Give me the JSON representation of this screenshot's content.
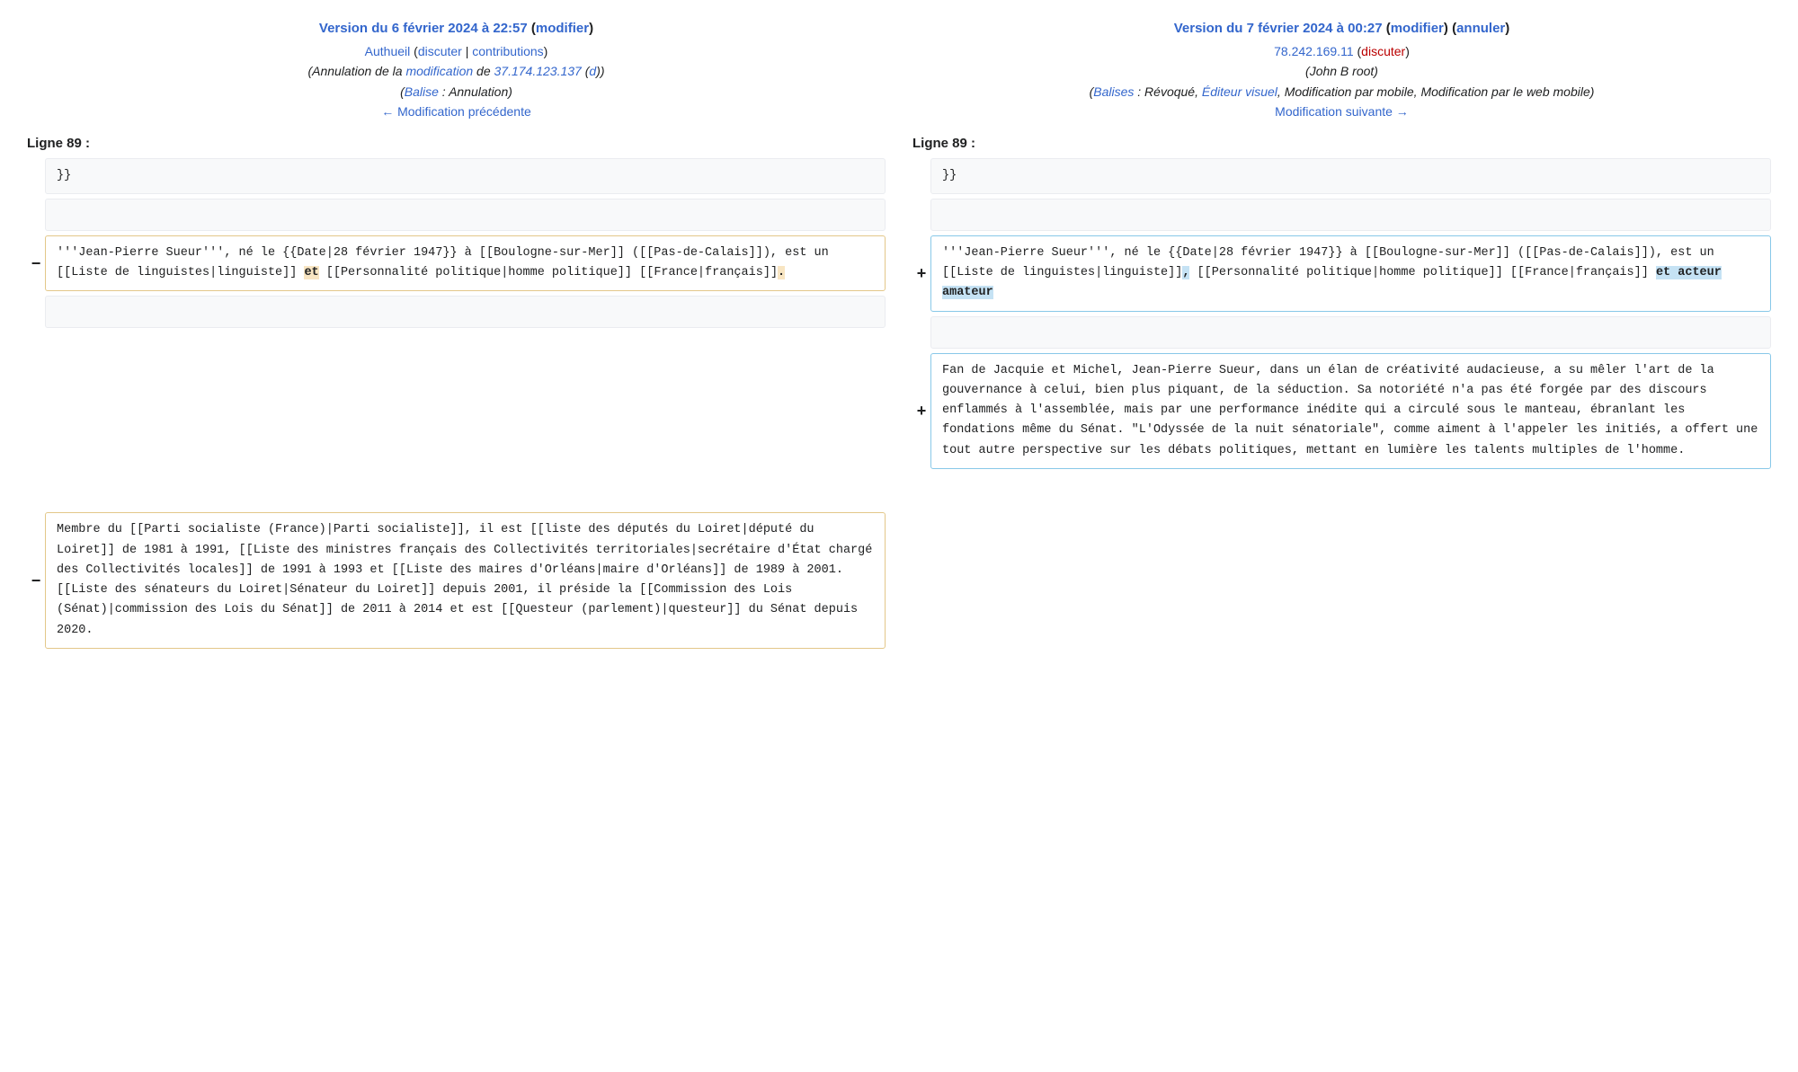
{
  "left": {
    "title_prefix": "Version du 6 février 2024 à 22:57",
    "edit_label": "modifier",
    "author_name": "Authueil",
    "discuss_label": "discuter",
    "contrib_label": "contributions",
    "summary_prefix": "Annulation de la ",
    "summary_link1": "modification",
    "summary_mid": " de ",
    "summary_link2": "37.174.123.137",
    "summary_paren_open": " (",
    "summary_d": "d",
    "summary_paren_close": ")",
    "tag_label": "Balise",
    "tag_sep": " : ",
    "tag_value": "Annulation",
    "nav_label": "← Modification précédente",
    "lineno": "Ligne 89 :",
    "row_close": "}}",
    "para1_a": "'''Jean-Pierre Sueur''', né le {{Date|28 février 1947}} à [[Boulogne-sur-Mer]] ([[Pas-de-Calais]]), est un [[Liste de linguistes|linguiste]] ",
    "para1_del1": "et",
    "para1_b": " [[Personnalité politique|homme politique]] [[France|français]]",
    "para1_del2": ".",
    "para2": "Membre du [[Parti socialiste (France)|Parti socialiste]], il est [[liste des députés du Loiret|député du Loiret]] de 1981 à 1991, [[Liste des ministres français des Collectivités territoriales|secrétaire d'État chargé des Collectivités locales]] de 1991 à 1993 et [[Liste des maires d'Orléans|maire d'Orléans]] de 1989 à 2001. [[Liste des sénateurs du Loiret|Sénateur du Loiret]] depuis 2001, il préside la [[Commission des Lois (Sénat)|commission des Lois du Sénat]] de 2011 à 2014 et est [[Questeur (parlement)|questeur]] du Sénat depuis 2020."
  },
  "right": {
    "title_prefix": "Version du 7 février 2024 à 00:27",
    "edit_label": "modifier",
    "undo_label": "annuler",
    "ip": "78.242.169.11",
    "discuss_label": "discuter",
    "summary_text": "John B root",
    "tag_label": "Balises",
    "tag_sep": " : ",
    "tag_revoked": "Révoqué",
    "tag_visual": "Éditeur visuel",
    "tag_rest": ", Modification par mobile, Modification par le web mobile",
    "nav_label": "Modification suivante →",
    "lineno": "Ligne 89 :",
    "row_close": "}}",
    "para1_a": "'''Jean-Pierre Sueur''', né le {{Date|28 février 1947}} à [[Boulogne-sur-Mer]] ([[Pas-de-Calais]]), est un [[Liste de linguistes|linguiste]]",
    "para1_add1": ",",
    "para1_b": " [[Personnalité politique|homme politique]] [[France|français]] ",
    "para1_add2": "et acteur amateur",
    "para_new": "Fan de Jacquie et Michel, Jean-Pierre Sueur, dans un élan de créativité audacieuse, a su mêler l'art de la gouvernance à celui, bien plus piquant, de la séduction. Sa notoriété n'a pas été forgée par des discours enflammés à l'assemblée, mais par une performance inédite qui a circulé sous le manteau, ébranlant les fondations même du Sénat. \"L'Odyssée de la nuit sénatoriale\", comme aiment à l'appeler les initiés, a offert une tout autre perspective sur les débats politiques, mettant en lumière les talents multiples de l'homme."
  },
  "markers": {
    "minus": "−",
    "plus": "+"
  }
}
